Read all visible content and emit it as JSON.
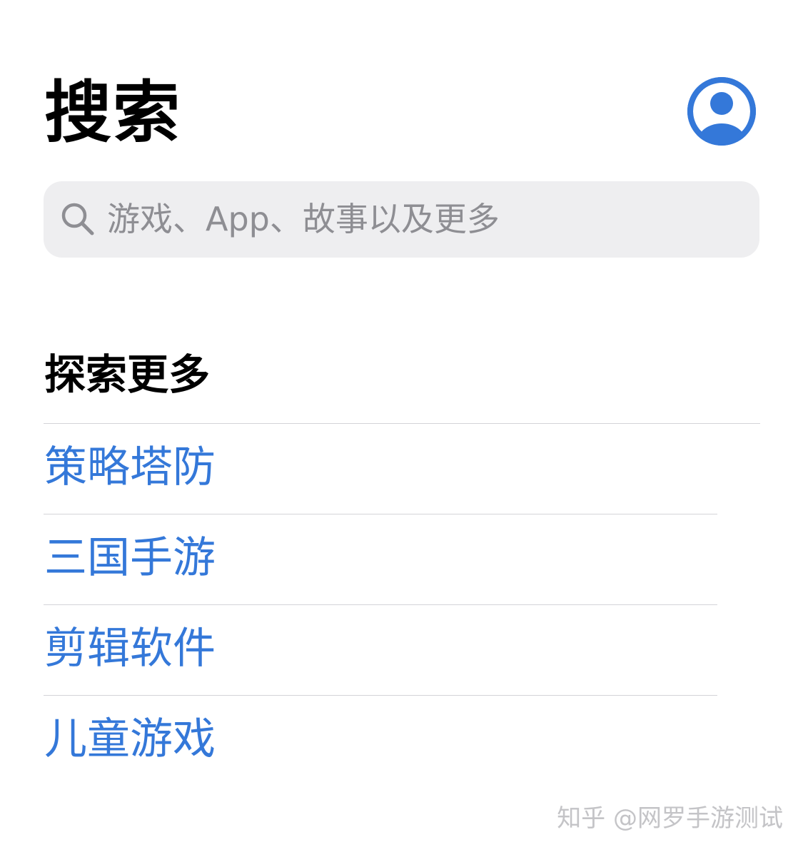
{
  "header": {
    "title": "搜索",
    "account_icon": "person-circle-icon",
    "accent_color": "#3478d9"
  },
  "search": {
    "icon": "magnifying-glass-icon",
    "placeholder": "游戏、App、故事以及更多"
  },
  "discover": {
    "title": "探索更多",
    "items": [
      {
        "label": "策略塔防"
      },
      {
        "label": "三国手游"
      },
      {
        "label": "剪辑软件"
      },
      {
        "label": "儿童游戏"
      }
    ]
  },
  "watermark": "知乎 @网罗手游测试"
}
